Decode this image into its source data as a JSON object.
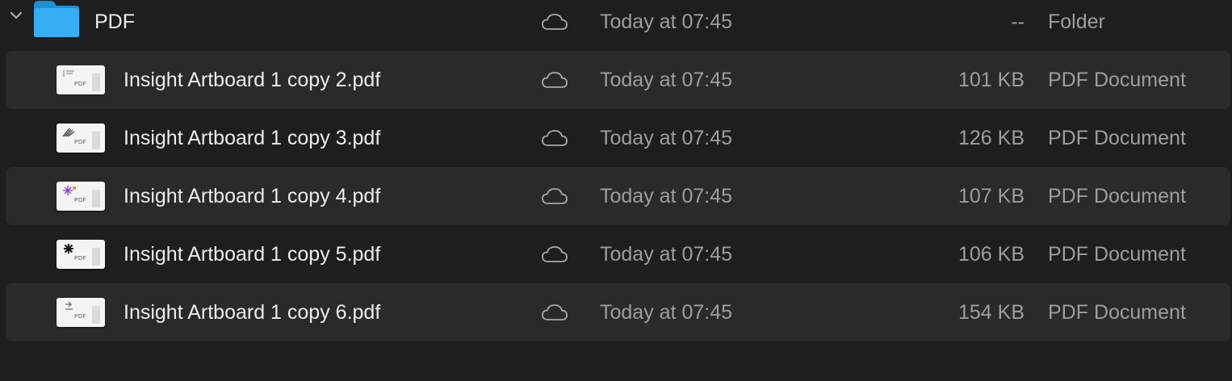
{
  "folder": {
    "name": "PDF",
    "date": "Today at 07:45",
    "size": "--",
    "kind": "Folder",
    "expanded": true,
    "color": "#2fa6f0"
  },
  "files": [
    {
      "name": "Insight Artboard 1 copy 2.pdf",
      "date": "Today at 07:45",
      "size": "101 KB",
      "kind": "PDF Document",
      "thumb_label": "PDF"
    },
    {
      "name": "Insight Artboard 1 copy 3.pdf",
      "date": "Today at 07:45",
      "size": "126 KB",
      "kind": "PDF Document",
      "thumb_label": "PDF"
    },
    {
      "name": "Insight Artboard 1 copy 4.pdf",
      "date": "Today at 07:45",
      "size": "107 KB",
      "kind": "PDF Document",
      "thumb_label": "PDF"
    },
    {
      "name": "Insight Artboard 1 copy 5.pdf",
      "date": "Today at 07:45",
      "size": "106 KB",
      "kind": "PDF Document",
      "thumb_label": "PDF"
    },
    {
      "name": "Insight Artboard 1 copy 6.pdf",
      "date": "Today at 07:45",
      "size": "154 KB",
      "kind": "PDF Document",
      "thumb_label": "PDF"
    }
  ],
  "icons": {
    "disclosure": "chevron-down-icon",
    "folder": "folder-icon",
    "file": "pdf-file-icon",
    "cloud": "cloud-icon"
  },
  "colors": {
    "background": "#1e1e1e",
    "stripe": "#2a2a2a",
    "text_primary": "#ececec",
    "text_secondary": "#9e9e9e"
  }
}
